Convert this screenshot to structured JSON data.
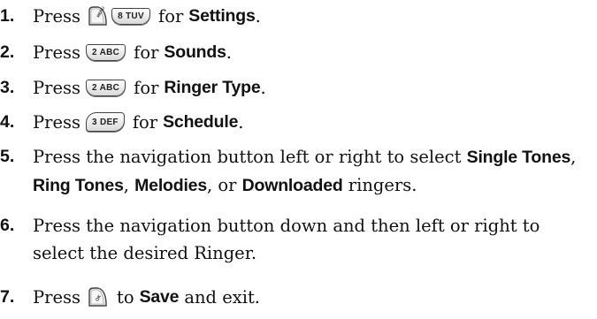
{
  "steps": [
    {
      "num": "1.",
      "press": "Press",
      "key1": "MENU",
      "key2": "8 TUV",
      "for": "for",
      "target": "Settings",
      "end": "."
    },
    {
      "num": "2.",
      "press": "Press",
      "key": "2 ABC",
      "for": "for",
      "target": "Sounds",
      "end": "."
    },
    {
      "num": "3.",
      "press": "Press",
      "key": "2 ABC",
      "for": "for",
      "target": "Ringer Type",
      "end": "."
    },
    {
      "num": "4.",
      "press": "Press",
      "key": "3 DEF",
      "for": "for",
      "target": "Schedule",
      "end": "."
    },
    {
      "num": "5.",
      "line1_a": "Press the navigation button left or right to select",
      "opt1": "Single Tones",
      "sep1": ",",
      "opt2": "Ring Tones",
      "sep2": ",",
      "opt3": "Melodies",
      "sep3": ", or",
      "opt4": "Downloaded",
      "line2_end": "ringers."
    },
    {
      "num": "6.",
      "line1": "Press the navigation button down and then left or right to",
      "line2": "select the desired Ringer."
    },
    {
      "num": "7.",
      "press": "Press",
      "key": "OK",
      "to": "to",
      "target": "Save",
      "end": "and exit."
    }
  ]
}
